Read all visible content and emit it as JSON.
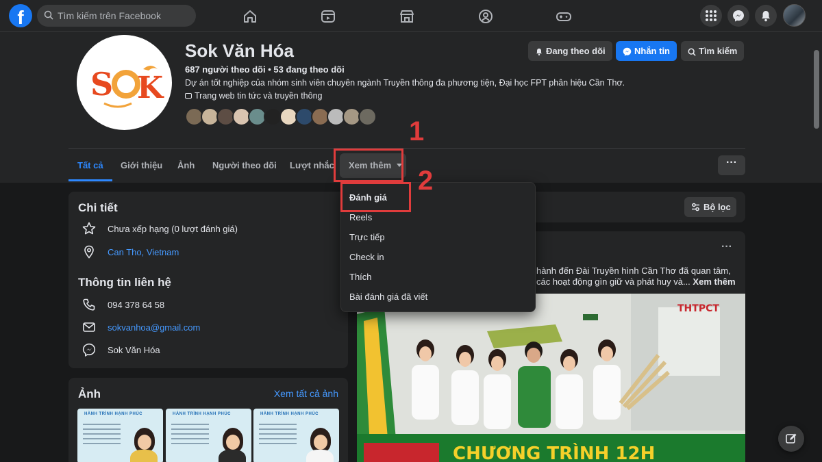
{
  "topbar": {
    "search_placeholder": "Tìm kiếm trên Facebook"
  },
  "profile": {
    "name": "Sok Văn Hóa",
    "followers": "687 người theo dõi",
    "following": "53 đang theo dõi",
    "description": "Dự án tốt nghiệp của nhóm sinh viên chuyên ngành Truyền thông đa phương tiện, Đại học FPT phân hiệu Cần Thơ.",
    "category": "Trang web tin tức và truyền thông",
    "buttons": {
      "following": "Đang theo dõi",
      "message": "Nhắn tin",
      "search": "Tìm kiếm"
    }
  },
  "tabs": [
    "Tất cả",
    "Giới thiệu",
    "Ảnh",
    "Người theo dõi",
    "Lượt nhắc",
    "Xem thêm"
  ],
  "details": {
    "title": "Chi tiết",
    "rating": "Chưa xếp hạng (0 lượt đánh giá)",
    "location": "Can Tho, Vietnam",
    "contact_title": "Thông tin liên hệ",
    "phone": "094 378 64 58",
    "email": "sokvanhoa@gmail.com",
    "messenger": "Sok Văn Hóa"
  },
  "photos": {
    "title": "Ảnh",
    "see_all": "Xem tất cả ảnh",
    "card_title": "HÀNH TRÌNH HẠNH PHÚC"
  },
  "filter_label": "Bộ lọc",
  "post": {
    "text_line1": "hành đến Đài Truyền hình Cần Thơ đã quan tâm,",
    "text_line2": "các hoạt động gìn giữ và phát huy và...",
    "see_more": "Xem thêm",
    "banner": "CHƯƠNG TRÌNH 12H",
    "logo": "THTPCT"
  },
  "dropdown": [
    "Đánh giá",
    "Reels",
    "Trực tiếp",
    "Check in",
    "Thích",
    "Bài đánh giá đã viết"
  ],
  "annotations": {
    "one": "1",
    "two": "2",
    "color": "#e03c3c"
  },
  "colors": {
    "accent": "#2d88ff",
    "brand": "#1877f2",
    "bg": "#18191a",
    "card": "#242526"
  }
}
